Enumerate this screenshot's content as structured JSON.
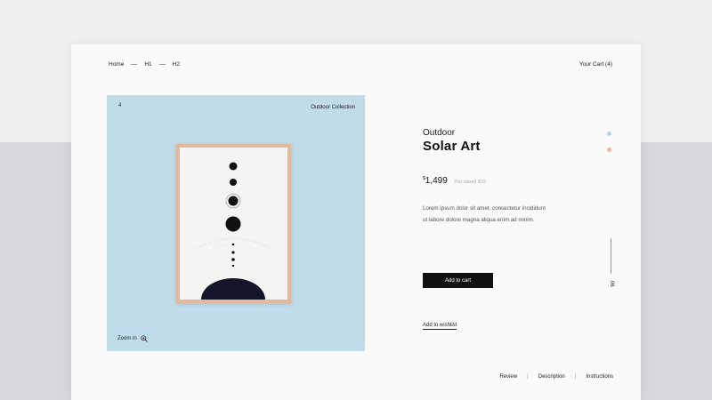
{
  "breadcrumb": {
    "items": [
      "Home",
      "H1",
      "H2"
    ]
  },
  "cart": {
    "label": "Your Cart (4)"
  },
  "image": {
    "index": "4",
    "collection": "Outdoor Collection",
    "zoom_label": "Zoom in",
    "background": "#bfdce8",
    "frame_color": "#e3b89c"
  },
  "product": {
    "subtitle": "Outdoor",
    "title": "Solar Art",
    "price_currency": "$",
    "price_value": "1,499",
    "saved": "You saved $32",
    "description": "Lorem ipsum dolor sit amet, consectetur incididunt ut labore dolore magna aliqua enim ad minim.",
    "add_to_cart": "Add to cart",
    "wishlist": "Add to wishlist"
  },
  "swatches": [
    "#b9d3e2",
    "#e8b69c"
  ],
  "slide_counter": "06",
  "tabs": [
    "Review",
    "Description",
    "Instructions"
  ],
  "icons": {
    "zoom": "zoom-in-icon"
  }
}
